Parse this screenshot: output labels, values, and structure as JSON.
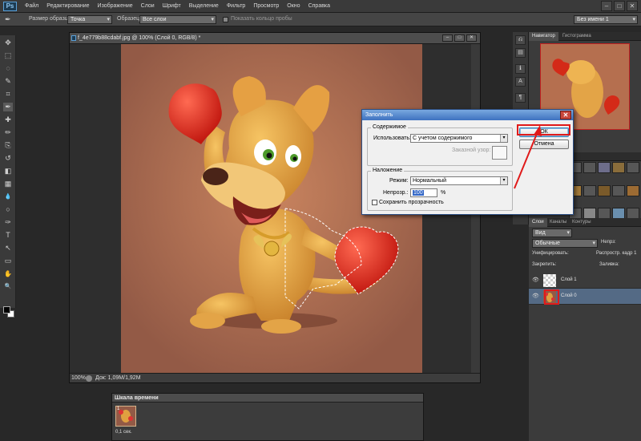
{
  "app": {
    "logo": "Ps",
    "menu": [
      "Файл",
      "Редактирование",
      "Изображение",
      "Слои",
      "Шрифт",
      "Выделение",
      "Фильтр",
      "Просмотр",
      "Окно",
      "Справка"
    ],
    "window_controls": [
      "–",
      "□",
      "✕"
    ]
  },
  "options_bar": {
    "sample_size_label": "Размер образца:",
    "sample_size_value": "Точка",
    "sample_label": "Образец:",
    "sample_value": "Все слои",
    "show_ring_label": "Показать кольцо пробы",
    "workspace_value": "Без имени 1"
  },
  "toolbar": {
    "icons": [
      "move-icon",
      "marquee-icon",
      "lasso-icon",
      "quick-select-icon",
      "crop-icon",
      "eyedropper-icon",
      "healing-icon",
      "brush-icon",
      "stamp-icon",
      "history-brush-icon",
      "eraser-icon",
      "gradient-icon",
      "blur-icon",
      "dodge-icon",
      "pen-icon",
      "type-icon",
      "path-select-icon",
      "shape-icon",
      "hand-icon",
      "zoom-icon"
    ],
    "glyphs": [
      "✥",
      "⬚",
      "◌",
      "✎",
      "⌗",
      "✒",
      "✚",
      "✏",
      "⎘",
      "↺",
      "◧",
      "▦",
      "💧",
      "○",
      "✑",
      "T",
      "↖",
      "▭",
      "✋",
      "🔍"
    ]
  },
  "document": {
    "title": "f_4e779b88cdabf.jpg @ 100% (Слой 0, RGB/8) *",
    "zoom": "100%",
    "doc_size": "Док: 1,09M/1,92M",
    "background_color": "#935a46"
  },
  "timeline": {
    "title": "Шкала времени",
    "frame_number": "1",
    "frame_time": "0,1 сек."
  },
  "navigator": {
    "tabs": [
      "Навигатор",
      "Гистограмма"
    ]
  },
  "layers_panel": {
    "tabs": [
      "Слои",
      "Каналы",
      "Контуры"
    ],
    "kind_label": "Вид",
    "blend_mode": "Обычные",
    "opacity_label": "Непрз:",
    "unify_label": "Унифицировать:",
    "propagate_label": "Распростр. кадр 1",
    "lock_label": "Закрепить:",
    "fill_label": "Заливка:",
    "layers": [
      {
        "name": "Слой 1",
        "selected": false
      },
      {
        "name": "Слой 0",
        "selected": true
      }
    ]
  },
  "dialog": {
    "title": "Заполнить",
    "content_group": "Содержимое",
    "use_label": "Использовать:",
    "use_value": "С учетом содержимого",
    "custom_pattern_label": "Заказной узор:",
    "blending_group": "Наложение",
    "mode_label": "Режим:",
    "mode_value": "Нормальный",
    "opacity_label": "Непрозр.:",
    "opacity_value": "100",
    "opacity_unit": "%",
    "preserve_label": "Сохранить прозрачность",
    "ok_label": "ОК",
    "cancel_label": "Отмена"
  },
  "colors": {
    "canvas_bg": "#935a46",
    "highlight": "#e01a1a",
    "dialog_title": "#3e72c0"
  }
}
